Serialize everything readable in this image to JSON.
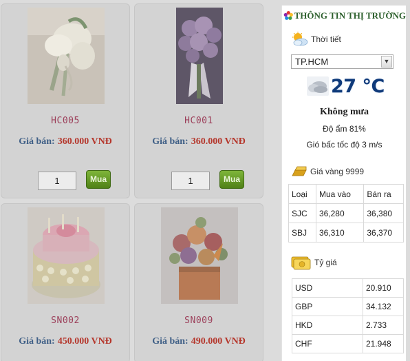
{
  "products": [
    {
      "code": "HC005",
      "price_label": "Giá bán:",
      "price": "360.000 VNĐ",
      "qty": "1",
      "buy_label": "Mua",
      "image": "white-orchid-bouquet"
    },
    {
      "code": "HC001",
      "price_label": "Giá bán:",
      "price": "360.000 VNĐ",
      "qty": "1",
      "buy_label": "Mua",
      "image": "purple-rose-bouquet"
    },
    {
      "code": "SN002",
      "price_label": "Giá bán:",
      "price": "450.000 VNĐ",
      "image": "flower-birthday-cake"
    },
    {
      "code": "SN009",
      "price_label": "Giá bán:",
      "price": "490.000 VNĐ",
      "image": "mixed-flower-box"
    }
  ],
  "market": {
    "title": "THÔNG TIN THỊ TRƯỜNG",
    "weather": {
      "label": "Thời tiết",
      "city": "TP.HCM",
      "temperature": "27 °C",
      "condition": "Không mưa",
      "humidity": "Độ ẩm 81%",
      "wind": "Gió bấc tốc độ 3 m/s"
    },
    "gold": {
      "label": "Giá vàng 9999",
      "headers": [
        "Loại",
        "Mua vào",
        "Bán ra"
      ],
      "rows": [
        [
          "SJC",
          "36,280",
          "36,380"
        ],
        [
          "SBJ",
          "36,310",
          "36,370"
        ]
      ]
    },
    "exchange": {
      "label": "Tỷ giá",
      "rows": [
        [
          "USD",
          "20.910"
        ],
        [
          "GBP",
          "34.132"
        ],
        [
          "HKD",
          "2.733"
        ],
        [
          "CHF",
          "21.948"
        ]
      ]
    }
  },
  "colors": {
    "overlay_bg": "#dcdcdc",
    "code": "#9c3f5a",
    "price_label": "#3f5f86",
    "price_value": "#b5372c",
    "buy_button": "#5f9220",
    "panel_title": "#2c5f2c",
    "temperature": "#0f3a7a"
  }
}
